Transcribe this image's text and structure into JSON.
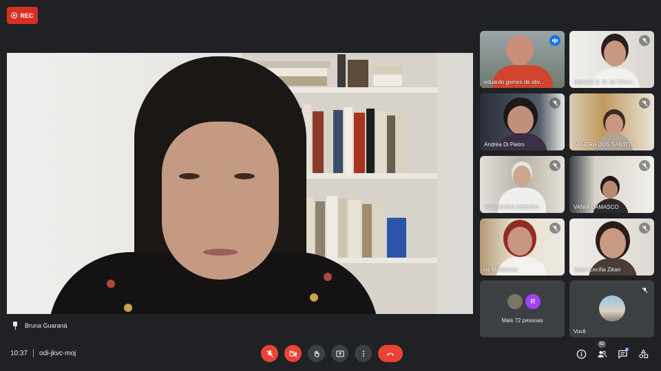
{
  "recording": {
    "label": "REC"
  },
  "main_speaker": {
    "name": "Bruna Guaraná"
  },
  "participants": [
    {
      "name": "eduardo gomes de oliv...",
      "state": "speaking"
    },
    {
      "name": "Nathalia S. M. de Olivei...",
      "state": "muted"
    },
    {
      "name": "Andréa Di Pietro",
      "state": "muted"
    },
    {
      "name": "SANDRA DOS SANTOS ...",
      "state": "muted"
    },
    {
      "name": "FERNANDO RIBEIRO",
      "state": "muted"
    },
    {
      "name": "VANIA DAMASCO",
      "state": "muted"
    },
    {
      "name": "ria Mendonça",
      "state": "muted"
    },
    {
      "name": "Maria Cecília Zikan",
      "state": "muted"
    }
  ],
  "more_tile": {
    "avatar_letter": "R",
    "label": "Mais 72 pessoas"
  },
  "self_tile": {
    "label": "Você"
  },
  "meeting": {
    "time": "10:37",
    "code": "odi-jkvc-moj"
  },
  "people_count": "82",
  "colors": {
    "accent": "#8ab4f8",
    "danger": "#ea4335",
    "surface": "#3c4043",
    "background": "#202124"
  }
}
